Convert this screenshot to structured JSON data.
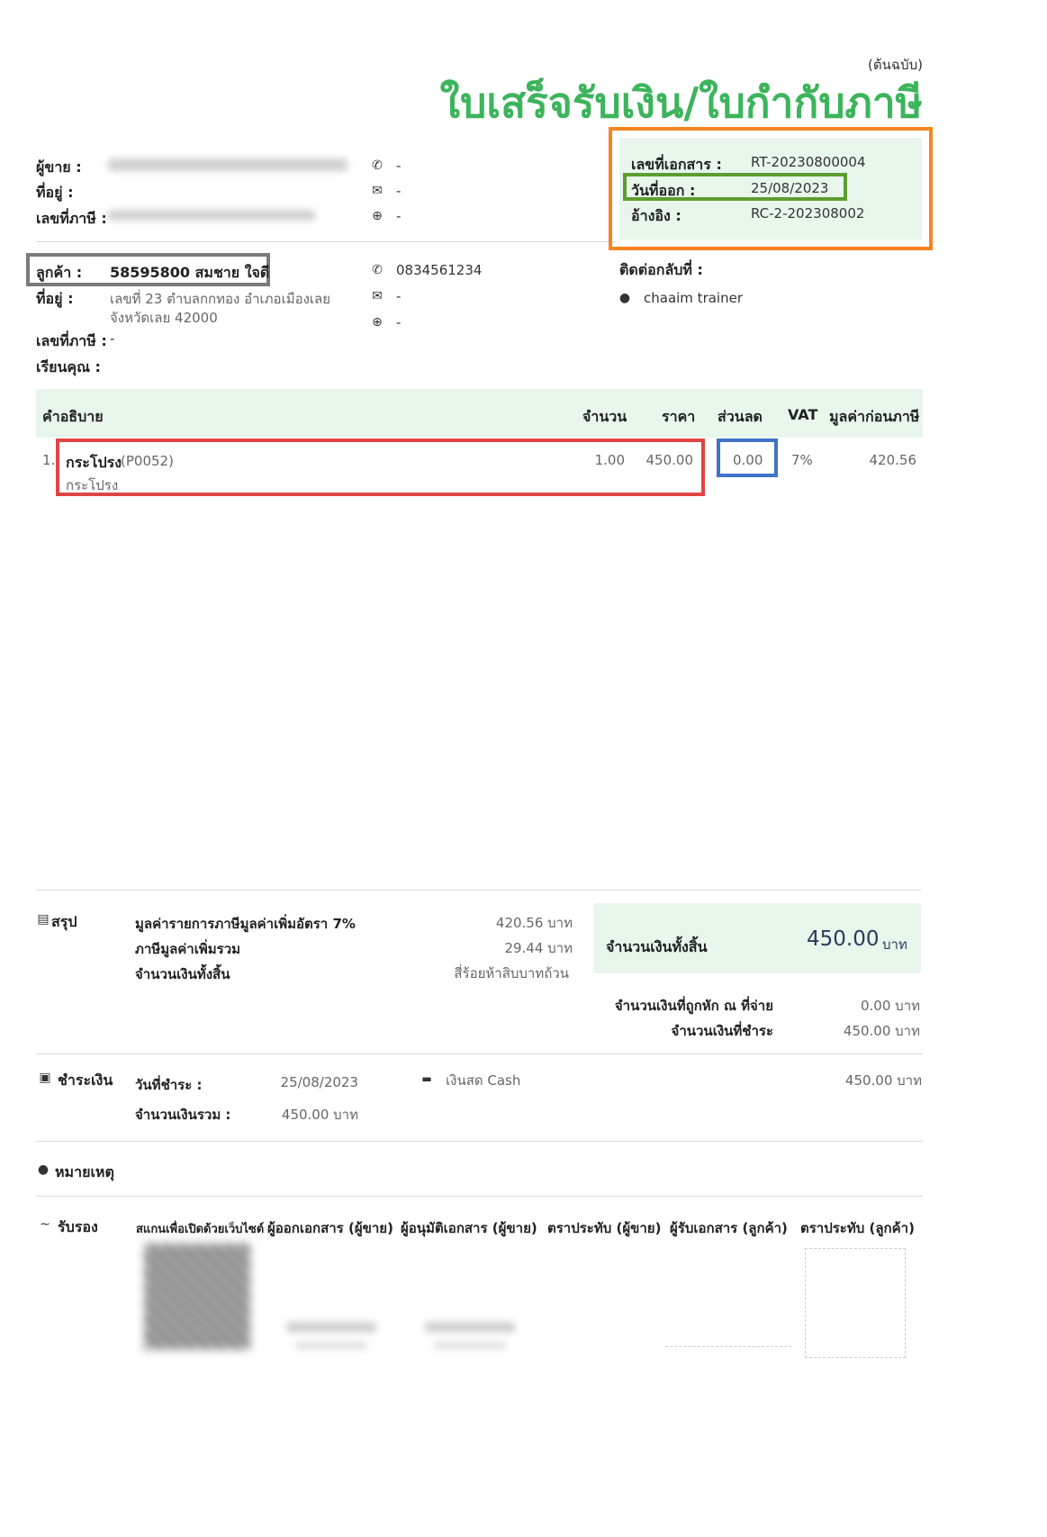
{
  "header": {
    "copy_label": "(ต้นฉบับ)",
    "title": "ใบเสร็จรับเงิน/ใบกำกับภาษี"
  },
  "seller": {
    "seller_label": "ผู้ขาย :",
    "address_label": "ที่อยู่ :",
    "tax_label": "เลขที่ภาษี :",
    "phone": "-",
    "email": "-",
    "web": "-"
  },
  "doc_info": {
    "doc_no_label": "เลขที่เอกสาร :",
    "doc_no": "RT-20230800004",
    "issue_date_label": "วันที่ออก :",
    "issue_date": "25/08/2023",
    "ref_label": "อ้างอิง :",
    "ref": "RC-2-202308002"
  },
  "customer": {
    "customer_label": "ลูกค้า :",
    "customer": "58595800 สมชาย ใจดี",
    "address_label": "ที่อยู่ :",
    "address_line1": "เลขที่ 23  ตำบลกกทอง อำเภอเมืองเลย",
    "address_line2": "จังหวัดเลย 42000",
    "tax_label": "เลขที่ภาษี :",
    "tax": "-",
    "attn_label": "เรียนคุณ :",
    "phone": "0834561234",
    "email": "-",
    "web": "-",
    "contact_label": "ติดต่อกลับที่ :",
    "contact_name": "chaaim trainer"
  },
  "table": {
    "headers": [
      "คำอธิบาย",
      "จำนวน",
      "ราคา",
      "ส่วนลด",
      "VAT",
      "มูลค่าก่อนภาษี"
    ],
    "rows": [
      {
        "no": "1.",
        "name": "กระโปรง",
        "code": "(P0052)",
        "desc": "กระโปรง",
        "qty": "1.00",
        "price": "450.00",
        "discount": "0.00",
        "vat": "7%",
        "amount": "420.56"
      }
    ]
  },
  "summary": {
    "section_label": "สรุป",
    "rows": [
      {
        "label": "มูลค่ารายการภาษีมูลค่าเพิ่มอัตรา 7%",
        "value": "420.56 บาท"
      },
      {
        "label": "ภาษีมูลค่าเพิ่มรวม",
        "value": "29.44 บาท"
      },
      {
        "label": "จำนวนเงินทั้งสิ้น",
        "value": "สี่ร้อยห้าสิบบาทถ้วน"
      }
    ],
    "total_label": "จำนวนเงินทั้งสิ้น",
    "total_value": "450.00",
    "total_unit": "บาท",
    "withheld_label": "จำนวนเงินที่ถูกหัก ณ ที่จ่าย",
    "withheld_value": "0.00 บาท",
    "paid_label": "จำนวนเงินที่ชำระ",
    "paid_value": "450.00 บาท"
  },
  "payment": {
    "section_label": "ชำระเงิน",
    "date_label": "วันที่ชำระ :",
    "date": "25/08/2023",
    "amount_label": "จำนวนเงินรวม :",
    "amount": "450.00 บาท",
    "method": "เงินสด Cash",
    "method_amount": "450.00 บาท"
  },
  "notes": {
    "section_label": "หมายเหตุ"
  },
  "signature": {
    "section_label": "รับรอง",
    "labels": [
      "สแกนเพื่อเปิดด้วยเว็บไซต์",
      "ผู้ออกเอกสาร (ผู้ขาย)",
      "ผู้อนุมัติเอกสาร (ผู้ขาย)",
      "ตราประทับ (ผู้ขาย)",
      "ผู้รับเอกสาร (ลูกค้า)",
      "ตราประทับ (ลูกค้า)"
    ]
  },
  "colors": {
    "title_green": "#3cb45c",
    "highlight_orange": "#f5841f",
    "highlight_green": "#5c9e2e",
    "highlight_gray": "#7a7a7a",
    "highlight_red": "#e04444",
    "highlight_blue": "#3f72c8",
    "panel_bg": "#e8f6ec",
    "total_navy": "#2b3a5c"
  }
}
